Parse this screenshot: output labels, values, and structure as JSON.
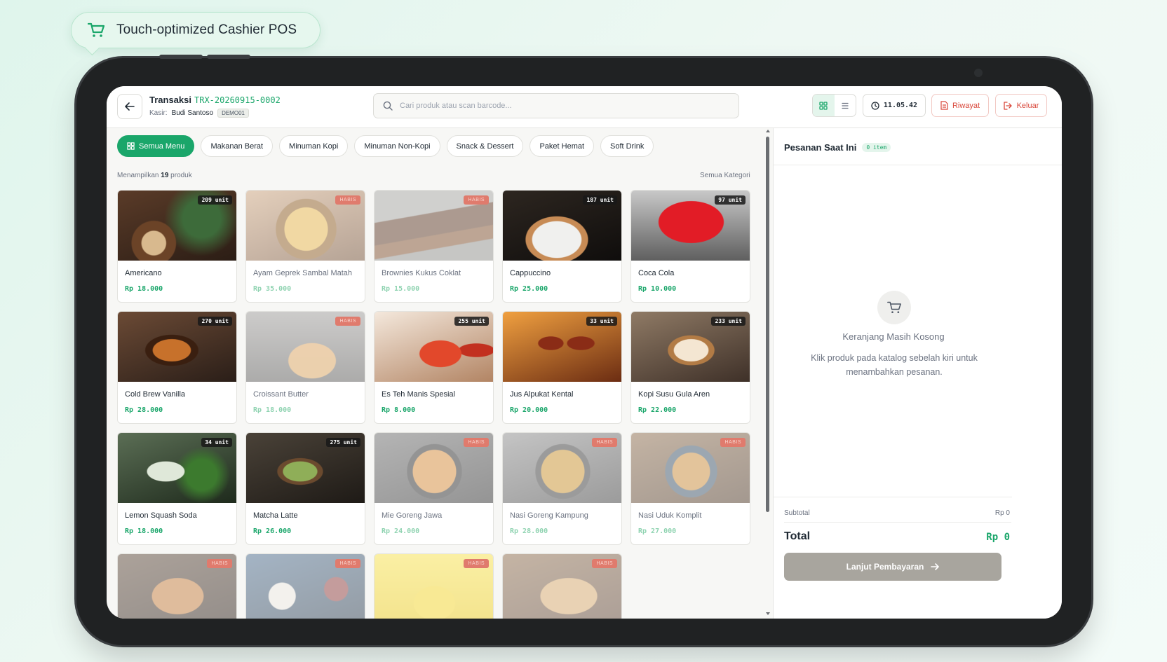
{
  "badge": {
    "title": "Touch-optimized Cashier POS"
  },
  "header": {
    "trx_label": "Transaksi",
    "trx_code": "TRX-20260915-0002",
    "kasir_label": "Kasir:",
    "kasir_name": "Budi Santoso",
    "kasir_tag": "DEMO01",
    "search_placeholder": "Cari produk atau scan barcode...",
    "clock": "11.05.42",
    "riwayat": "Riwayat",
    "keluar": "Keluar"
  },
  "categories": [
    "Semua Menu",
    "Makanan Berat",
    "Minuman Kopi",
    "Minuman Non-Kopi",
    "Snack & Dessert",
    "Paket Hemat",
    "Soft Drink"
  ],
  "catalog": {
    "showing_prefix": "Menampilkan",
    "showing_count": "19",
    "showing_suffix": "produk",
    "filter_label": "Semua Kategori"
  },
  "products": [
    {
      "name": "Americano",
      "price": "Rp 18.000",
      "stock": "209 unit",
      "out": false,
      "img": "coffee"
    },
    {
      "name": "Ayam Geprek Sambal Matah",
      "price": "Rp 35.000",
      "stock": "HABIS",
      "out": true,
      "img": "food"
    },
    {
      "name": "Brownies Kukus Coklat",
      "price": "Rp 15.000",
      "stock": "HABIS",
      "out": true,
      "img": "choco"
    },
    {
      "name": "Cappuccino",
      "price": "Rp 25.000",
      "stock": "187 unit",
      "out": false,
      "img": "capp"
    },
    {
      "name": "Coca Cola",
      "price": "Rp 10.000",
      "stock": "97 unit",
      "out": false,
      "img": "cola"
    },
    {
      "name": "Cold Brew Vanilla",
      "price": "Rp 28.000",
      "stock": "270 unit",
      "out": false,
      "img": "coldbrew"
    },
    {
      "name": "Croissant Butter",
      "price": "Rp 18.000",
      "stock": "HABIS",
      "out": true,
      "img": "croissant"
    },
    {
      "name": "Es Teh Manis Spesial",
      "price": "Rp 8.000",
      "stock": "255 unit",
      "out": false,
      "img": "tea"
    },
    {
      "name": "Jus Alpukat Kental",
      "price": "Rp 20.000",
      "stock": "33 unit",
      "out": false,
      "img": "wine"
    },
    {
      "name": "Kopi Susu Gula Aren",
      "price": "Rp 22.000",
      "stock": "233 unit",
      "out": false,
      "img": "latte"
    },
    {
      "name": "Lemon Squash Soda",
      "price": "Rp 18.000",
      "stock": "34 unit",
      "out": false,
      "img": "soda"
    },
    {
      "name": "Matcha Latte",
      "price": "Rp 26.000",
      "stock": "275 unit",
      "out": false,
      "img": "matcha"
    },
    {
      "name": "Mie Goreng Jawa",
      "price": "Rp 24.000",
      "stock": "HABIS",
      "out": true,
      "img": "noodle"
    },
    {
      "name": "Nasi Goreng Kampung",
      "price": "Rp 28.000",
      "stock": "HABIS",
      "out": true,
      "img": "rice"
    },
    {
      "name": "Nasi Uduk Komplit",
      "price": "Rp 27.000",
      "stock": "HABIS",
      "out": true,
      "img": "uduk"
    },
    {
      "name": "",
      "price": "",
      "stock": "HABIS",
      "out": true,
      "img": "sandwich"
    },
    {
      "name": "",
      "price": "",
      "stock": "HABIS",
      "out": true,
      "img": "breakfast"
    },
    {
      "name": "",
      "price": "",
      "stock": "HABIS",
      "out": true,
      "img": "banana"
    },
    {
      "name": "",
      "price": "",
      "stock": "HABIS",
      "out": true,
      "img": "toast"
    }
  ],
  "cart": {
    "title": "Pesanan Saat Ini",
    "count": "0 item",
    "empty_title": "Keranjang Masih Kosong",
    "empty_desc": "Klik produk pada katalog sebelah kiri untuk menambahkan pesanan.",
    "subtotal_label": "Subtotal",
    "subtotal_value": "Rp 0",
    "total_label": "Total",
    "total_value": "Rp 0",
    "pay_label": "Lanjut Pembayaran"
  },
  "colors": {
    "accent": "#1aa66a",
    "danger": "#d9483b",
    "bezel": "#202223"
  }
}
